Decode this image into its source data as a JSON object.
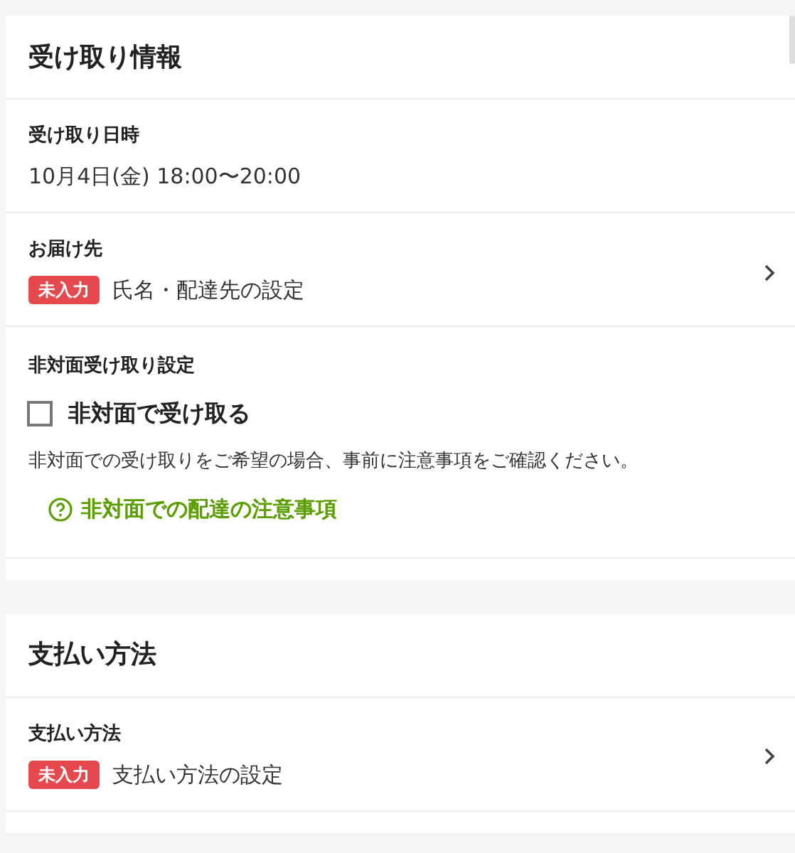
{
  "sections": [
    {
      "title": "受け取り情報",
      "rows": [
        {
          "kind": "text",
          "label": "受け取り日時",
          "value": "10月4日(金) 18:00〜20:00"
        },
        {
          "kind": "nav",
          "label": "お届け先",
          "badge": "未入力",
          "value": "氏名・配達先の設定"
        },
        {
          "kind": "checkbox",
          "label": "非対面受け取り設定",
          "option": "非対面で受け取る",
          "checked": false,
          "note": "非対面での受け取りをご希望の場合、事前に注意事項をご確認ください。",
          "link": "非対面での配達の注意事項"
        }
      ]
    },
    {
      "title": "支払い方法",
      "rows": [
        {
          "kind": "nav",
          "label": "支払い方法",
          "badge": "未入力",
          "value": "支払い方法の設定"
        }
      ]
    }
  ]
}
